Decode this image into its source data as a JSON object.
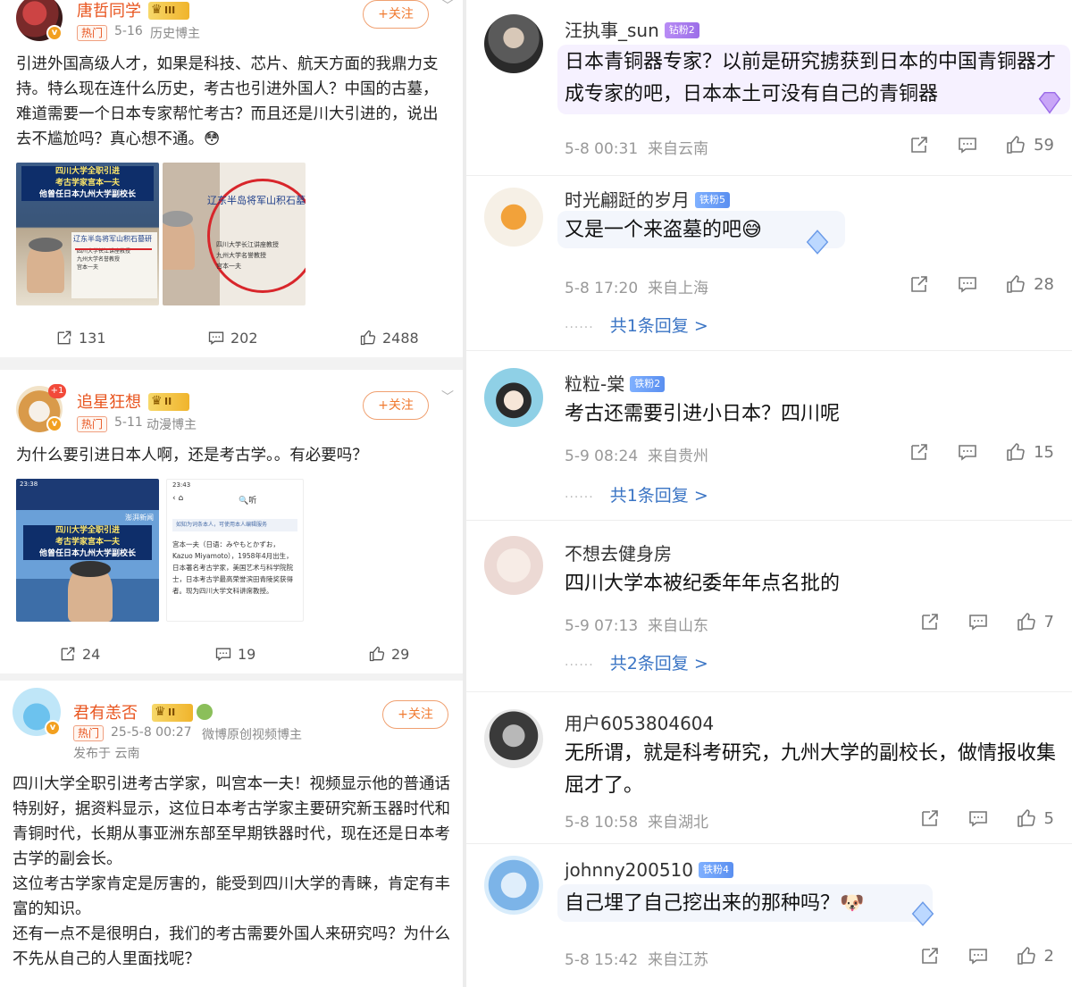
{
  "posts": [
    {
      "username": "唐哲同学",
      "level": "III",
      "hot": "热门",
      "date": "5-16",
      "tag": "历史博主",
      "follow": "+关注",
      "text": "引进外国高级人才，如果是科技、芯片、航天方面的我鼎力支持。特么现在连什么历史，考古也引进外国人？中国的古墓，难道需要一个日本专家帮忙考古？而且还是川大引进的，说出去不尴尬吗？真心想不通。😳",
      "image1": {
        "caption1": "四川大学全职引进",
        "caption2": "考古学家宫本一夫",
        "caption3": "他曾任日本九州大学副校长",
        "slide_title": "辽东半岛将军山积石墓研",
        "slide_line1": "四川大学长江讲座教授",
        "slide_line2": "九州大学名誉教授",
        "slide_line3": "宫本一夫"
      },
      "image2": {
        "slide_title": "辽东半岛将军山积石墓",
        "slide_line1": "四川大学长江讲座教授",
        "slide_line2": "九州大学名誉教授",
        "slide_line3": "宫本一夫"
      },
      "shares": "131",
      "comments": "202",
      "likes": "2488"
    },
    {
      "username": "追星狂想",
      "level": "II",
      "hot": "热门",
      "date": "5-11",
      "tag": "动漫博主",
      "follow": "+关注",
      "plus_one": "+1",
      "text": "为什么要引进日本人啊，还是考古学。。有必要吗？",
      "image1": {
        "time": "23:38",
        "caption1": "四川大学全职引进",
        "caption2": "考古学家宫本一夫",
        "caption3": "他曾任日本九州大学副校长",
        "logo": "澎湃新闻"
      },
      "image2": {
        "time": "23:43",
        "search": "听",
        "notice": "如知为词条本人，可使用本人编辑服务",
        "body": "宫本一夫（日语：みやもとかずお，Kazuo Miyamoto），1958年4月出生，日本著名考古学家，美国艺术与科学院院士，日本考古学最高荣誉滨田青陵奖获得者。现为四川大学文科讲席教授。"
      },
      "shares": "24",
      "comments": "19",
      "likes": "29"
    },
    {
      "username": "君有恙否",
      "level": "II",
      "hot": "热门",
      "date": "25-5-8 00:27",
      "tag": "微博原创视频博主",
      "location": "发布于 云南",
      "follow": "+关注",
      "paragraphs": [
        "四川大学全职引进考古学家，叫宫本一夫！视频显示他的普通话特别好，据资料显示，这位日本考古学家主要研究新玉器时代和青铜时代，长期从事亚洲东部至早期铁器时代，现在还是日本考古学的副会长。",
        "这位考古学家肯定是厉害的，能受到四川大学的青睐，肯定有丰富的知识。",
        "还有一点不是很明白，我们的考古需要外国人来研究吗？为什么不先从自己的人里面找呢？"
      ]
    }
  ],
  "comments": [
    {
      "name": "汪执事_sun",
      "badge": "钻粉2",
      "badge_type": "diamond",
      "text": "日本青铜器专家？以前是研究掳获到日本的中国青铜器才成专家的吧，日本本土可没有自己的青铜器",
      "time": "5-8 00:31",
      "location": "来自云南",
      "likes": "59",
      "replies": ""
    },
    {
      "name": "时光翩跹的岁月",
      "badge": "铁粉5",
      "badge_type": "iron",
      "text": "又是一个来盗墓的吧😅",
      "time": "5-8 17:20",
      "location": "来自上海",
      "likes": "28",
      "replies": "共1条回复 >"
    },
    {
      "name": "粒粒-棠",
      "badge": "铁粉2",
      "badge_type": "iron",
      "text": "考古还需要引进小日本？四川呢",
      "time": "5-9 08:24",
      "location": "来自贵州",
      "likes": "15",
      "replies": "共1条回复 >"
    },
    {
      "name": "不想去健身房",
      "badge": "",
      "badge_type": "",
      "text": "四川大学本被纪委年年点名批的",
      "time": "5-9 07:13",
      "location": "来自山东",
      "likes": "7",
      "replies": "共2条回复 >"
    },
    {
      "name": "用户6053804604",
      "badge": "",
      "badge_type": "",
      "text": "无所谓，就是科考研究，九州大学的副校长，做情报收集屈才了。",
      "time": "5-8 10:58",
      "location": "来自湖北",
      "likes": "5",
      "replies": ""
    },
    {
      "name": "johnny200510",
      "badge": "铁粉4",
      "badge_type": "iron",
      "text": "自己埋了自己挖出来的那种吗？🐶",
      "time": "5-8 15:42",
      "location": "来自江苏",
      "likes": "2",
      "replies": ""
    }
  ],
  "colors": {
    "username": "#e8541e",
    "follow": "#f07a30",
    "reply_link": "#3a74c4",
    "meta": "#999999"
  },
  "icons": [
    "share-icon",
    "comment-icon",
    "like-icon",
    "chevron-down-icon",
    "crown-icon",
    "diamond-icon",
    "verified-icon"
  ]
}
